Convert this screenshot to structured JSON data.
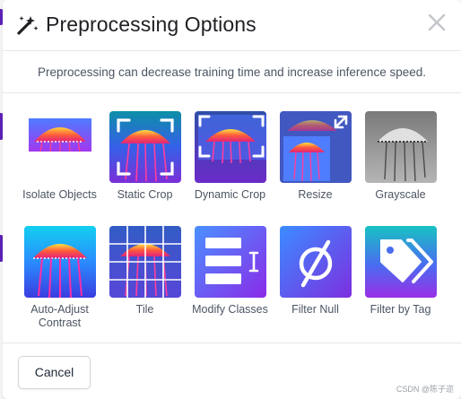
{
  "dialog": {
    "title": "Preprocessing Options",
    "description": "Preprocessing can decrease training time and increase inference speed.",
    "cancel_label": "Cancel"
  },
  "options": [
    {
      "label": "Isolate Objects",
      "icon": "jellyfish-image-icon"
    },
    {
      "label": "Static Crop",
      "icon": "crop-corners-icon"
    },
    {
      "label": "Dynamic Crop",
      "icon": "crop-corners-icon"
    },
    {
      "label": "Resize",
      "icon": "expand-arrow-icon"
    },
    {
      "label": "Grayscale",
      "icon": "jellyfish-grayscale-icon"
    },
    {
      "label": "Auto-Adjust Contrast",
      "icon": "jellyfish-contrast-icon"
    },
    {
      "label": "Tile",
      "icon": "grid-icon"
    },
    {
      "label": "Modify Classes",
      "icon": "class-list-icon"
    },
    {
      "label": "Filter Null",
      "icon": "null-set-icon"
    },
    {
      "label": "Filter by Tag",
      "icon": "tags-icon"
    }
  ],
  "watermark": "CSDN @陈子迩",
  "colors": {
    "accent_purple": "#7c3aed",
    "accent_blue": "#3b6cf6",
    "border": "#e5e7eb"
  }
}
